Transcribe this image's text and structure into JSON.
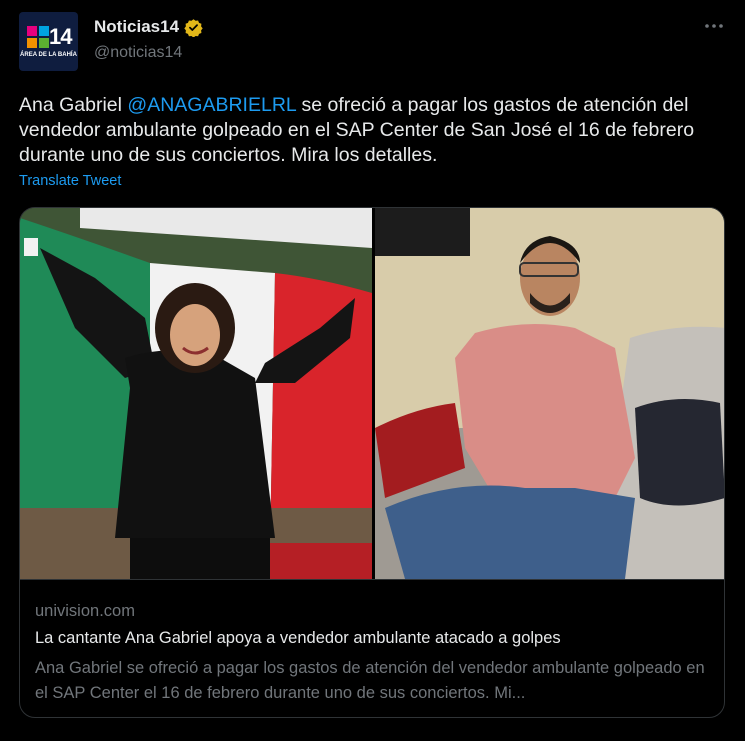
{
  "account": {
    "name": "Noticias14",
    "handle": "@noticias14",
    "avatar_number": "14",
    "avatar_subtitle": "ÁREA DE LA BAHÍA",
    "verified_color": "#e2b719"
  },
  "tweet": {
    "text_before": "Ana Gabriel ",
    "mention": "@ANAGABRIELRL",
    "text_after": " se ofreció a pagar los gastos de atención del vendedor ambulante golpeado en el SAP Center de San José el 16 de febrero durante uno de sus conciertos. Mira los detalles.",
    "translate_label": "Translate Tweet"
  },
  "card": {
    "domain": "univision.com",
    "title": "La cantante Ana Gabriel apoya a vendedor ambulante atacado a golpes",
    "description": "Ana Gabriel se ofreció a pagar los gastos de atención del vendedor ambulante golpeado en el SAP Center el 16 de febrero durante uno de sus conciertos. Mi..."
  },
  "icons": {
    "more": "more-options-icon",
    "verified": "verified-badge-icon"
  },
  "colors": {
    "background": "#000000",
    "link": "#1d9bf0",
    "muted": "#71767b"
  }
}
